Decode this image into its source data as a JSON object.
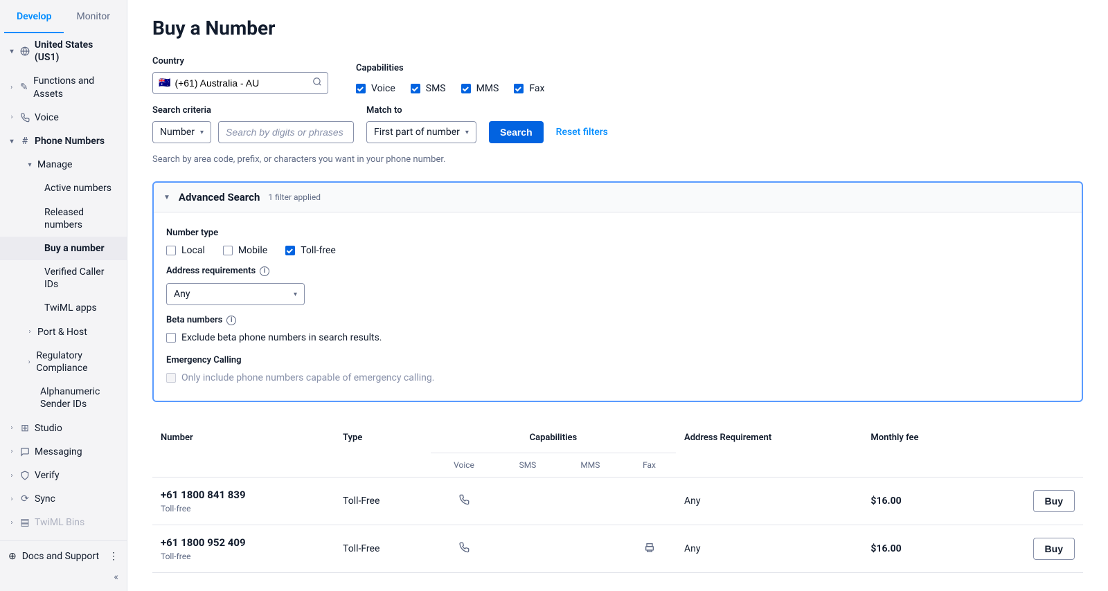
{
  "sidebar": {
    "tabs": {
      "develop": "Develop",
      "monitor": "Monitor"
    },
    "region": "United States (US1)",
    "items": {
      "functions": "Functions and Assets",
      "voice": "Voice",
      "phone_numbers": "Phone Numbers",
      "manage": "Manage",
      "active": "Active numbers",
      "released": "Released numbers",
      "buy": "Buy a number",
      "verified": "Verified Caller IDs",
      "twiml_apps": "TwiML apps",
      "port_host": "Port & Host",
      "regulatory": "Regulatory Compliance",
      "alphanumeric": "Alphanumeric Sender IDs",
      "studio": "Studio",
      "messaging": "Messaging",
      "verify": "Verify",
      "sync": "Sync",
      "twiml_bins": "TwiML Bins"
    },
    "docs": "Docs and Support"
  },
  "page": {
    "title": "Buy a Number",
    "country_label": "Country",
    "country_value": "(+61) Australia - AU",
    "capabilities_label": "Capabilities",
    "caps": {
      "voice": "Voice",
      "sms": "SMS",
      "mms": "MMS",
      "fax": "Fax"
    },
    "search_criteria_label": "Search criteria",
    "criteria_value": "Number",
    "search_placeholder": "Search by digits or phrases",
    "match_label": "Match to",
    "match_value": "First part of number",
    "search_btn": "Search",
    "reset_link": "Reset filters",
    "hint": "Search by area code, prefix, or characters you want in your phone number."
  },
  "advanced": {
    "title": "Advanced Search",
    "badge": "1 filter applied",
    "number_type_label": "Number type",
    "local": "Local",
    "mobile": "Mobile",
    "tollfree": "Toll-free",
    "address_label": "Address requirements",
    "address_value": "Any",
    "beta_label": "Beta numbers",
    "beta_text": "Exclude beta phone numbers in search results.",
    "emergency_label": "Emergency Calling",
    "emergency_text": "Only include phone numbers capable of emergency calling."
  },
  "results": {
    "headers": {
      "number": "Number",
      "type": "Type",
      "capabilities": "Capabilities",
      "address": "Address Requirement",
      "fee": "Monthly fee",
      "voice": "Voice",
      "sms": "SMS",
      "mms": "MMS",
      "fax": "Fax"
    },
    "rows": [
      {
        "number": "+61 1800 841 839",
        "sub": "Toll-free",
        "type": "Toll-Free",
        "voice": true,
        "sms": false,
        "mms": false,
        "fax": false,
        "address": "Any",
        "fee": "$16.00",
        "buy": "Buy"
      },
      {
        "number": "+61 1800 952 409",
        "sub": "Toll-free",
        "type": "Toll-Free",
        "voice": true,
        "sms": false,
        "mms": false,
        "fax": true,
        "address": "Any",
        "fee": "$16.00",
        "buy": "Buy"
      }
    ]
  }
}
